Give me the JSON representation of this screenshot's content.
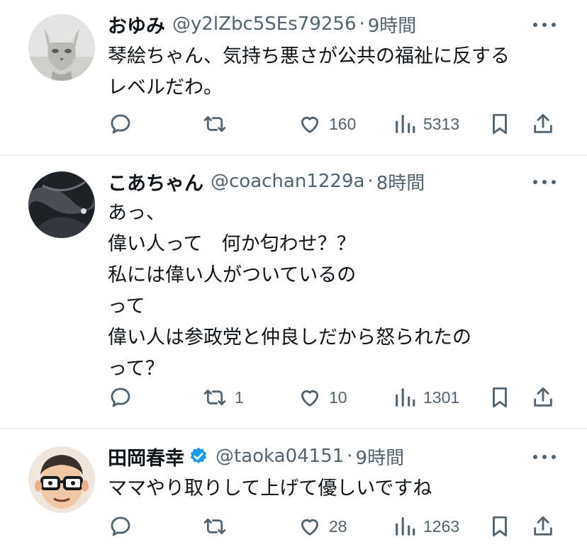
{
  "tweets": [
    {
      "name": "おゆみ",
      "handle": "@y2lZbc5SEs79256",
      "separator": "·",
      "time": "9時間",
      "verified": false,
      "body": "琴絵ちゃん、気持ち悪さが公共の福祉に反する\nレベルだわ。",
      "reply_count": "",
      "retweet_count": "",
      "like_count": "160",
      "view_count": "5313",
      "avatar": "gray-cat-photo"
    },
    {
      "name": "こあちゃん",
      "handle": "@coachan1229a",
      "separator": "·",
      "time": "8時間",
      "verified": false,
      "body": "あっ、\n偉い人って　何か匂わせ？？\n私には偉い人がついているの\nって\n偉い人は参政党と仲良しだから怒られたの\nって？",
      "reply_count": "",
      "retweet_count": "1",
      "like_count": "10",
      "view_count": "1301",
      "avatar": "dark-abstract-photo"
    },
    {
      "name": "田岡春幸",
      "handle": "@taoka04151",
      "separator": "·",
      "time": "9時間",
      "verified": true,
      "body": "ママやり取りして上げて優しいですね",
      "reply_count": "",
      "retweet_count": "",
      "like_count": "28",
      "view_count": "1263",
      "avatar": "cartoon-man-with-glasses"
    }
  ],
  "icons": {
    "reply": "reply-icon",
    "retweet": "retweet-icon",
    "like": "heart-icon",
    "views": "views-icon",
    "bookmark": "bookmark-icon",
    "share": "share-icon",
    "more": "more-icon",
    "verified": "verified-badge-icon"
  },
  "colors": {
    "text": "#0f1419",
    "secondary": "#536471",
    "divider": "#eff3f4",
    "verified": "#1d9bf0"
  }
}
